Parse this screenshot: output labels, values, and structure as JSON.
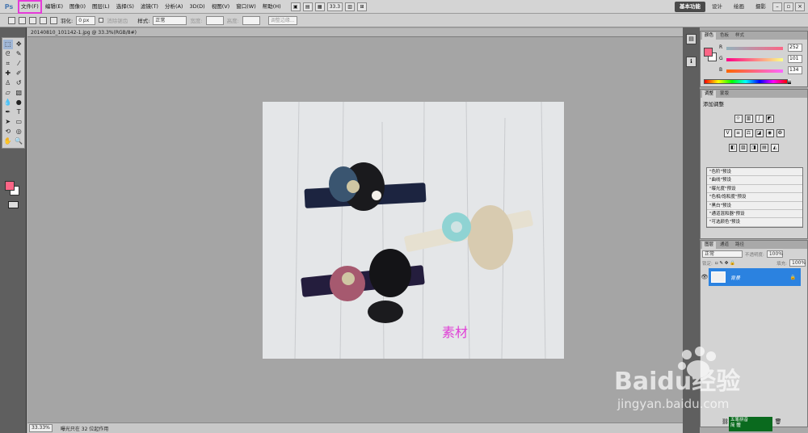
{
  "menubar": {
    "logo": "Ps",
    "items": [
      "文件(F)",
      "编辑(E)",
      "图像(I)",
      "图层(L)",
      "选择(S)",
      "滤镜(T)",
      "分析(A)",
      "3D(D)",
      "视图(V)",
      "窗口(W)",
      "帮助(H)"
    ],
    "zoom_value": "33.3",
    "workspaces": [
      "基本功能",
      "设计",
      "绘画",
      "摄影"
    ],
    "active_workspace": "基本功能"
  },
  "optbar": {
    "feather_label": "羽化:",
    "feather_value": "0 px",
    "antialias_label": "消除锯齿",
    "style_label": "样式:",
    "style_value": "正常",
    "width_label": "宽度:",
    "height_label": "高度:",
    "refine_label": "调整边缘..."
  },
  "document": {
    "tab_title": "20140810_101142-1.jpg @ 33.3%(RGB/8#)",
    "watermark_text": "素材"
  },
  "statusbar": {
    "zoom": "33.33%",
    "info": "曝光只在 32 位起作用"
  },
  "color_panel": {
    "tabs": [
      "颜色",
      "色板",
      "样式"
    ],
    "r_label": "R",
    "r_value": "252",
    "g_label": "G",
    "g_value": "101",
    "b_label": "B",
    "b_value": "134"
  },
  "adjust_panel": {
    "tabs": [
      "调整",
      "蒙版"
    ],
    "heading": "添加调整",
    "presets": [
      "\"色阶\"预设",
      "\"曲线\"预设",
      "\"曝光度\"预设",
      "\"色相/饱和度\"预设",
      "\"黑白\"预设",
      "\"通道混和器\"预设",
      "\"可选颜色\"预设"
    ]
  },
  "layers_panel": {
    "tabs": [
      "图层",
      "通道",
      "路径"
    ],
    "blend_mode": "正常",
    "opacity_label": "不透明度:",
    "opacity_value": "100%",
    "lock_label": "锁定:",
    "fill_label": "填充:",
    "fill_value": "100%",
    "layer_name": "背景"
  },
  "ime": {
    "line1": "五笔拼音",
    "line2": "简 體"
  },
  "watermark": {
    "brand": "Baidu经验",
    "url": "jingyan.baidu.com"
  },
  "colors": {
    "foreground": "#fc6586",
    "highlight_box": "#e53ad8",
    "layer_selected": "#2b82e0"
  }
}
